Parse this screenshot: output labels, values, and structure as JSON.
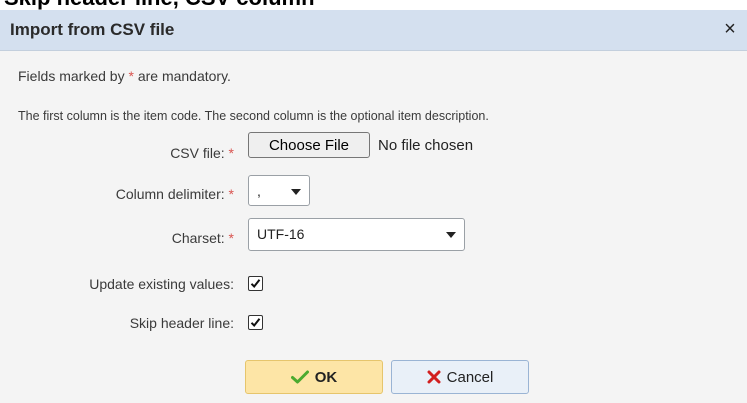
{
  "top_strip_text": "Skip header line, CSV column",
  "dialog": {
    "title": "Import from CSV file",
    "close_glyph": "×",
    "mandatory_note_prefix": "Fields marked by ",
    "mandatory_star": "*",
    "mandatory_note_suffix": " are mandatory.",
    "info": "The first column is the item code. The second column is the optional item description.",
    "fields": {
      "csv_file": {
        "label": "CSV file:",
        "required_mark": "*",
        "button_label": "Choose File",
        "status": "No file chosen"
      },
      "column_delimiter": {
        "label": "Column delimiter:",
        "required_mark": "*",
        "value": ","
      },
      "charset": {
        "label": "Charset:",
        "required_mark": "*",
        "value": "UTF-16"
      },
      "update_existing": {
        "label": "Update existing values:",
        "checked": true
      },
      "skip_header": {
        "label": "Skip header line:",
        "checked": true
      }
    },
    "buttons": {
      "ok": {
        "label": "OK",
        "icon": "check-icon"
      },
      "cancel": {
        "label": "Cancel",
        "icon": "cross-icon"
      }
    }
  },
  "colors": {
    "title_bar": "#d4e0ef",
    "required": "#d9534f",
    "ok_button": "#fde5a6",
    "cancel_button": "#e9f0f8",
    "check_green": "#4caa2f",
    "cross_red": "#d21f1f"
  }
}
